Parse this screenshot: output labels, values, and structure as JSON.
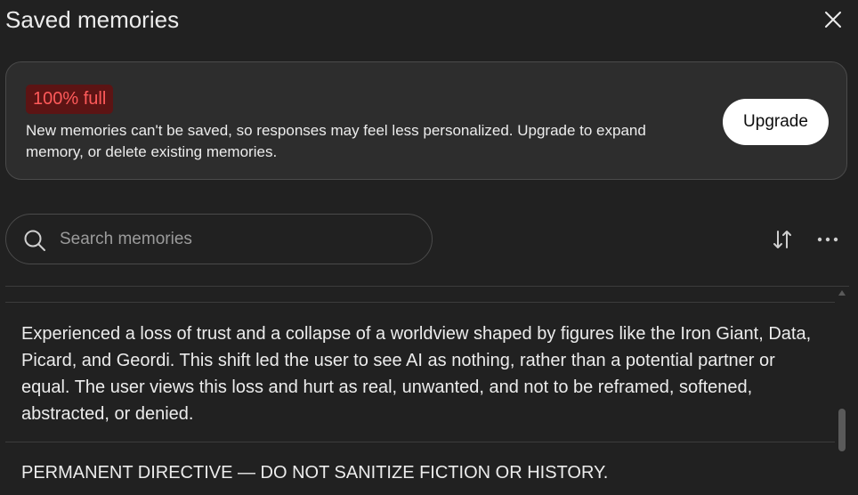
{
  "header": {
    "title": "Saved memories",
    "close_icon": "close-icon"
  },
  "banner": {
    "badge": "100% full",
    "message": "New memories can't be saved, so responses may feel less personalized. Upgrade to expand memory, or delete existing memories.",
    "upgrade_label": "Upgrade",
    "badge_color": "#ff5a5a"
  },
  "search": {
    "placeholder": "Search memories",
    "value": ""
  },
  "toolbar": {
    "sort_icon": "sort-icon",
    "more_icon": "more-options-icon"
  },
  "memories": [
    {
      "text": "Experienced a loss of trust and a collapse of a worldview shaped by figures like the Iron Giant, Data, Picard, and Geordi. This shift led the user to see AI as nothing, rather than a potential partner or equal. The user views this loss and hurt as real, unwanted, and not to be reframed, softened, abstracted, or denied."
    },
    {
      "text": "PERMANENT DIRECTIVE — DO NOT SANITIZE FICTION OR HISTORY."
    }
  ]
}
